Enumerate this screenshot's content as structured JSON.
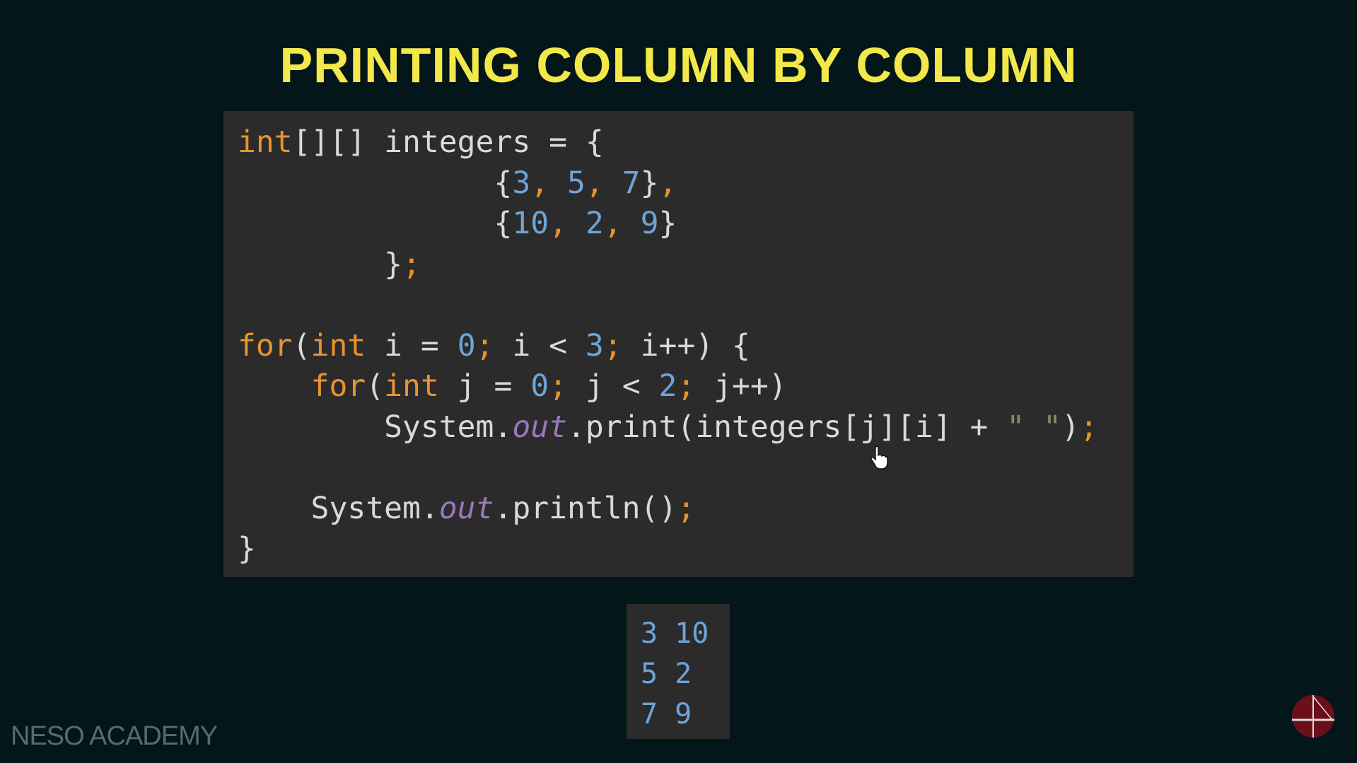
{
  "title": "PRINTING COLUMN BY COLUMN",
  "code_lines": [
    [
      [
        "int",
        "kw"
      ],
      [
        "[][] integers = {",
        ""
      ]
    ],
    [
      [
        "              {",
        ""
      ],
      [
        "3",
        "num"
      ],
      [
        ",",
        "pun"
      ],
      [
        " ",
        ""
      ],
      [
        "5",
        "num"
      ],
      [
        ",",
        "pun"
      ],
      [
        " ",
        ""
      ],
      [
        "7",
        "num"
      ],
      [
        "}",
        ""
      ],
      [
        ",",
        "pun"
      ]
    ],
    [
      [
        "              {",
        ""
      ],
      [
        "10",
        "num"
      ],
      [
        ",",
        "pun"
      ],
      [
        " ",
        ""
      ],
      [
        "2",
        "num"
      ],
      [
        ",",
        "pun"
      ],
      [
        " ",
        ""
      ],
      [
        "9",
        "num"
      ],
      [
        "}",
        ""
      ]
    ],
    [
      [
        "        }",
        ""
      ],
      [
        ";",
        "pun"
      ]
    ],
    [],
    [
      [
        "for",
        "kw"
      ],
      [
        "(",
        ""
      ],
      [
        "int",
        "kw"
      ],
      [
        " i = ",
        ""
      ],
      [
        "0",
        "num"
      ],
      [
        ";",
        "pun"
      ],
      [
        " i < ",
        ""
      ],
      [
        "3",
        "num"
      ],
      [
        ";",
        "pun"
      ],
      [
        " i++) {",
        ""
      ]
    ],
    [
      [
        "    ",
        ""
      ],
      [
        "for",
        "kw"
      ],
      [
        "(",
        ""
      ],
      [
        "int",
        "kw"
      ],
      [
        " j = ",
        ""
      ],
      [
        "0",
        "num"
      ],
      [
        ";",
        "pun"
      ],
      [
        " j < ",
        ""
      ],
      [
        "2",
        "num"
      ],
      [
        ";",
        "pun"
      ],
      [
        " j++)",
        ""
      ]
    ],
    [
      [
        "        System.",
        ""
      ],
      [
        "out",
        "fld"
      ],
      [
        ".print(integers[j][i] + ",
        ""
      ],
      [
        "\" \"",
        "str"
      ],
      [
        ")",
        ""
      ],
      [
        ";",
        "pun"
      ]
    ],
    [],
    [
      [
        "    System.",
        ""
      ],
      [
        "out",
        "fld"
      ],
      [
        ".println()",
        ""
      ],
      [
        ";",
        "pun"
      ]
    ],
    [
      [
        "}",
        ""
      ]
    ]
  ],
  "output_lines": [
    "3 10",
    "5 2",
    "7 9"
  ],
  "brand": "NESO ACADEMY",
  "colors": {
    "background": "#03161a",
    "panel": "#2b2b2b",
    "title": "#f3e84a",
    "keyword": "#e8932f",
    "number": "#6fa3d6",
    "field": "#9a78b8"
  },
  "icons": {
    "logo": "neso-academy-logo",
    "cursor": "hand-pointer-icon"
  }
}
